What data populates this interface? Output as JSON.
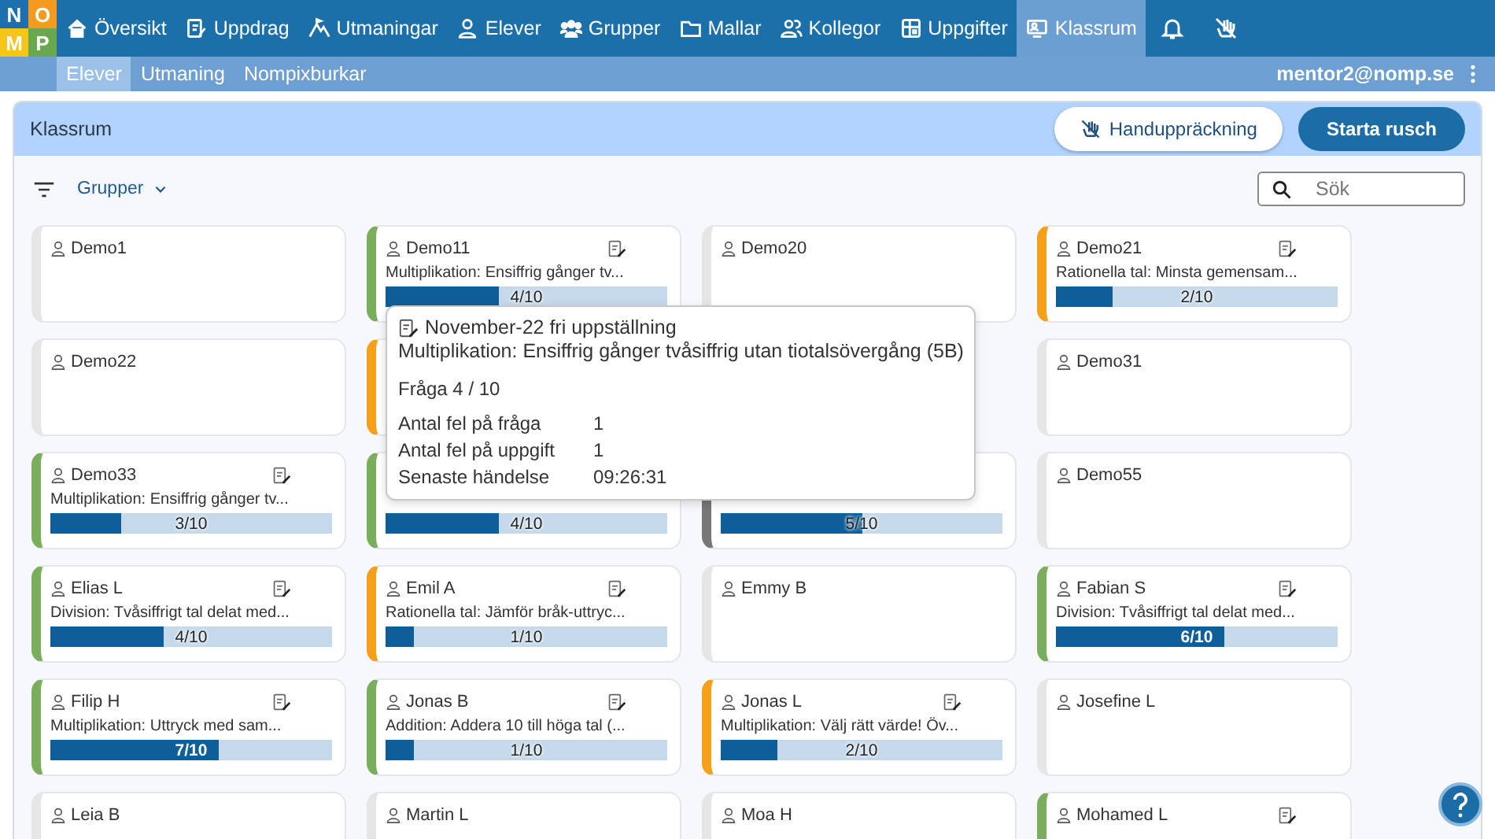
{
  "logo": [
    {
      "letter": "N",
      "color": "#1e6fae"
    },
    {
      "letter": "O",
      "color": "#f39a1f"
    },
    {
      "letter": "M",
      "color": "#f5c518"
    },
    {
      "letter": "P",
      "color": "#6aa84f"
    }
  ],
  "nav": [
    {
      "label": "Översikt",
      "selected": false
    },
    {
      "label": "Uppdrag",
      "selected": false
    },
    {
      "label": "Utmaningar",
      "selected": false
    },
    {
      "label": "Elever",
      "selected": false
    },
    {
      "label": "Grupper",
      "selected": false
    },
    {
      "label": "Mallar",
      "selected": false
    },
    {
      "label": "Kollegor",
      "selected": false
    },
    {
      "label": "Uppgifter",
      "selected": false
    },
    {
      "label": "Klassrum",
      "selected": true
    }
  ],
  "subnav": [
    {
      "label": "Elever",
      "selected": true
    },
    {
      "label": "Utmaning",
      "selected": false
    },
    {
      "label": "Nompixburkar",
      "selected": false
    }
  ],
  "user": "mentor2@nomp.se",
  "panel": {
    "title": "Klassrum",
    "hand_button": "Handuppräckning",
    "start_button": "Starta rusch",
    "group_filter": "Grupper",
    "search": {
      "placeholder": "Sök"
    }
  },
  "cards": [
    {
      "name": "Demo1",
      "color": "#e6e6e6"
    },
    {
      "name": "Demo11",
      "color": "#7aae5c",
      "task": "Multiplikation: Ensiffrig gånger tv...",
      "level": 0.4,
      "progress": "4/10"
    },
    {
      "name": "Demo20",
      "color": "#e6e6e6"
    },
    {
      "name": "Demo21",
      "color": "#f5a01a",
      "task": "Rationella tal: Minsta gemensam...",
      "level": 0.2,
      "progress": "2/10"
    },
    {
      "name": "Demo22",
      "color": "#e6e6e6"
    },
    {
      "color": "#f5a01a"
    },
    {
      "kind": "covered"
    },
    {
      "name": "Demo31",
      "color": "#e6e6e6"
    },
    {
      "name": "Demo33",
      "color": "#7aae5c",
      "task": "Multiplikation: Ensiffrig gånger tv...",
      "level": 0.25,
      "progress": "3/10"
    },
    {
      "color": "#7aae5c",
      "level": 0.4,
      "progress": "4/10"
    },
    {
      "color": "#777777",
      "level": 0.5,
      "progress": "5/10"
    },
    {
      "name": "Demo55",
      "color": "#e6e6e6"
    },
    {
      "name": "Elias L",
      "color": "#7aae5c",
      "task": "Division: Tvåsiffrigt tal delat med...",
      "level": 0.4,
      "progress": "4/10"
    },
    {
      "name": "Emil A",
      "color": "#f5a01a",
      "task": "Rationella tal: Jämför bråk-uttryc...",
      "level": 0.1,
      "progress": "1/10"
    },
    {
      "name": "Emmy B",
      "color": "#e6e6e6"
    },
    {
      "name": "Fabian S",
      "color": "#7aae5c",
      "task": "Division: Tvåsiffrigt tal delat med...",
      "level": 0.6,
      "progress": "6/10"
    },
    {
      "name": "Filip H",
      "color": "#7aae5c",
      "task": "Multiplikation: Uttryck med sam...",
      "level": 0.6,
      "progress": "7/10"
    },
    {
      "name": "Jonas B",
      "color": "#7aae5c",
      "task": "Addition: Addera 10 till höga tal (...",
      "level": 0.1,
      "progress": "1/10"
    },
    {
      "name": "Jonas L",
      "color": "#f5a01a",
      "task": "Multiplikation: Välj rätt värde! Öv...",
      "level": 0.2,
      "progress": "2/10"
    },
    {
      "name": "Josefine L",
      "color": "#e6e6e6"
    },
    {
      "name": "Leia B",
      "color": "#e6e6e6"
    },
    {
      "name": "Martin L",
      "color": "#e6e6e6"
    },
    {
      "name": "Moa H",
      "color": "#e6e6e6"
    },
    {
      "name": "Mohamed L",
      "color": "#7aae5c",
      "edit": true
    }
  ],
  "tooltip": {
    "title": "November-22 fri uppställning",
    "task": "Multiplikation: Ensiffrig gånger tvåsiffrig utan tiotalsövergång (5B)",
    "question": "Fråga 4 / 10",
    "stats": [
      {
        "label": "Antal fel på fråga",
        "value": "1"
      },
      {
        "label": "Antal fel på uppgift",
        "value": "1"
      },
      {
        "label": "Senaste händelse",
        "value": "09:26:31"
      }
    ]
  }
}
